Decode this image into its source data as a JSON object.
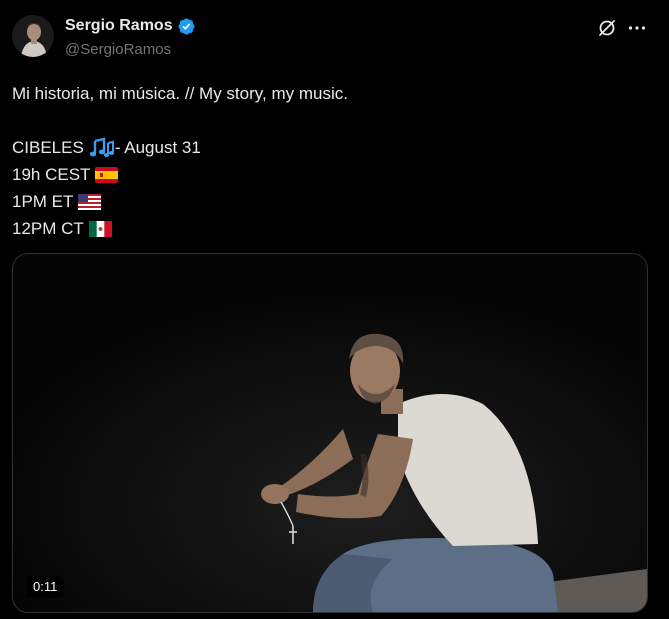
{
  "author": {
    "display_name": "Sergio Ramos",
    "handle": "@SergioRamos",
    "verified": true
  },
  "icons": {
    "avatar": "avatar",
    "verified": "verified-badge-icon",
    "grok": "grok-icon",
    "more": "more-options-icon"
  },
  "tweet": {
    "line1": "Mi historia, mi música. // My story, my music.",
    "line2": "CIBELES",
    "line2_suffix": " - August 31",
    "line3": "19h CEST",
    "line4": "1PM ET",
    "line5": "12PM CT",
    "emojis": [
      "musical-notes-emoji",
      "spain-flag-emoji",
      "usa-flag-emoji",
      "mexico-flag-emoji"
    ]
  },
  "media": {
    "type": "video",
    "duration": "0:11"
  },
  "colors": {
    "background": "#000000",
    "text": "#e7e9ea",
    "secondary": "#71767b",
    "verified": "#1d9bf0",
    "border": "#2f3336"
  }
}
